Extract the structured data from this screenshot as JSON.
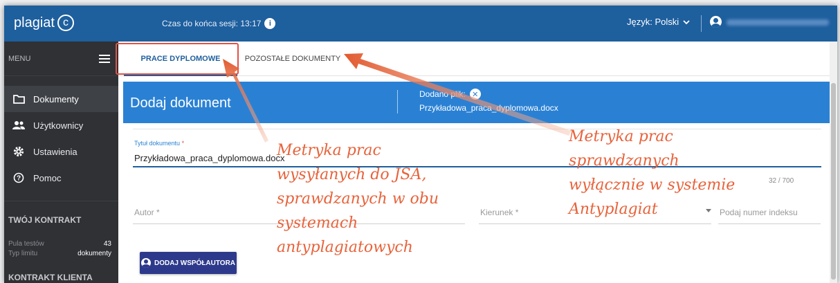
{
  "header": {
    "logo": "plagiat",
    "logo_mark": "c",
    "session_text": "Czas do końca sesji: 13:17",
    "language_label": "Język: Polski"
  },
  "sidebar": {
    "menu_label": "MENU",
    "items": [
      {
        "label": "Dokumenty",
        "icon": "folder-icon"
      },
      {
        "label": "Użytkownicy",
        "icon": "users-icon"
      },
      {
        "label": "Ustawienia",
        "icon": "gear-icon"
      },
      {
        "label": "Pomoc",
        "icon": "help-icon"
      }
    ],
    "contract_title": "TWÓJ KONTRAKT",
    "pool_label": "Pula testów",
    "pool_value": "43",
    "limit_label": "Typ limitu",
    "limit_value": "dokumenty",
    "client_contract_title": "KONTRAKT KLIENTA"
  },
  "tabs": [
    {
      "label": "PRACE DYPLOMOWE",
      "active": true
    },
    {
      "label": "POZOSTAŁE DOKUMENTY",
      "active": false
    }
  ],
  "card": {
    "title": "Dodaj dokument",
    "added_label": "Dodano plik:",
    "added_file": "Przykładowa_praca_dyplomowa.docx"
  },
  "form": {
    "title_label": "Tytuł dokumentu",
    "required_mark": "*",
    "title_value": "Przykładowa_praca_dyplomowa.docx",
    "counter": "32 / 700",
    "author_placeholder": "Autor *",
    "field_placeholder": "Kierunek *",
    "index_placeholder": "Podaj numer indeksu",
    "add_coauthor_button": "DODAJ WSPÓŁAUTORA"
  },
  "annotations": {
    "left": [
      "Metryka prac",
      "wysyłanych do JSA,",
      "sprawdzanych w obu",
      "systemach",
      "antyplagiatowych"
    ],
    "right": [
      "Metryka prac",
      "sprawdzanych",
      "wyłącznie w systemie",
      "Antyplagiat"
    ]
  },
  "colors": {
    "topbar": "#1e5f9e",
    "sidebar": "#2f3135",
    "card_header": "#2a81d4",
    "button": "#2d3a8c",
    "annotation": "#e8623a",
    "highlight": "#e15245"
  }
}
